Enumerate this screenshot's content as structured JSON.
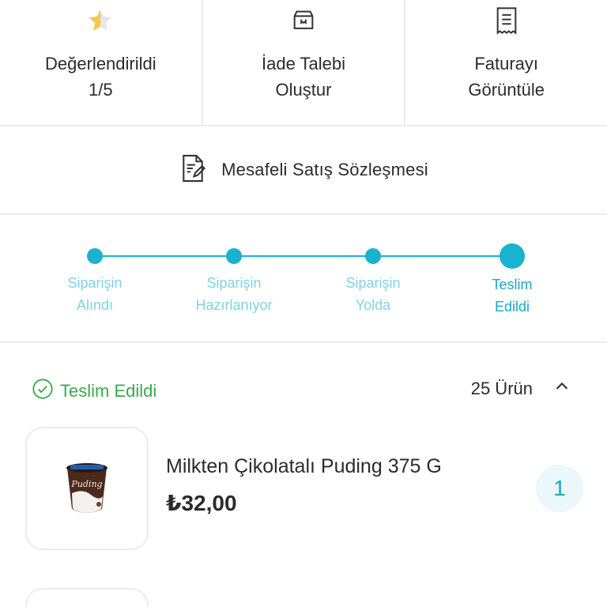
{
  "actions": [
    {
      "icon": "star-half-icon",
      "line1": "Değerlendirildi",
      "line2": "1/5"
    },
    {
      "icon": "return-box-icon",
      "line1": "İade Talebi",
      "line2": "Oluştur"
    },
    {
      "icon": "invoice-icon",
      "line1": "Faturayı",
      "line2": "Görüntüle"
    }
  ],
  "contract": {
    "icon": "document-edit-icon",
    "label": "Mesafeli Satış Sözleşmesi"
  },
  "tracker": {
    "steps": [
      {
        "line1": "Siparişin",
        "line2": "Alındı"
      },
      {
        "line1": "Siparişin",
        "line2": "Hazırlanıyor"
      },
      {
        "line1": "Siparişin",
        "line2": "Yolda"
      },
      {
        "line1": "Teslim",
        "line2": "Edildi"
      }
    ],
    "active_index": 3
  },
  "status": {
    "label": "Teslim Edildi",
    "count": "25 Ürün"
  },
  "product": {
    "name": "Milkten Çikolatalı Puding 375 G",
    "price": "₺32,00",
    "quantity": "1"
  },
  "colors": {
    "accent": "#19b3cf",
    "success": "#3aa94f",
    "divider": "#ececec"
  }
}
